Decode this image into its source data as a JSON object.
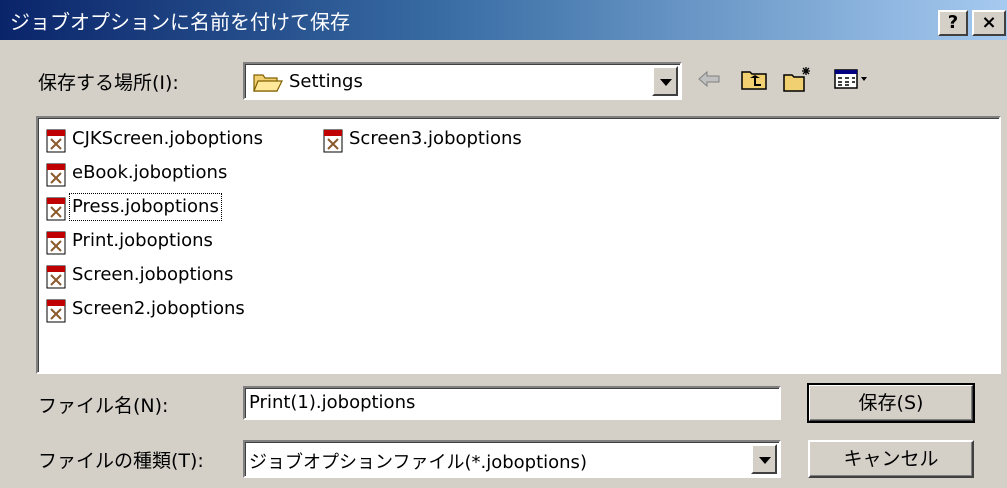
{
  "window": {
    "title": "ジョブオプションに名前を付けて保存",
    "help_button": "?",
    "close_button": "×"
  },
  "save_in": {
    "label": "保存する場所(I):",
    "value": "Settings"
  },
  "toolbar": {
    "icons": [
      "back-arrow-icon",
      "up-one-level-icon",
      "new-folder-icon",
      "view-menu-icon"
    ]
  },
  "file_list": {
    "items": [
      {
        "name": "CJKScreen.joboptions"
      },
      {
        "name": "Screen3.joboptions"
      },
      {
        "name": "eBook.joboptions"
      },
      {
        "name": "Press.joboptions"
      },
      {
        "name": "Print.joboptions"
      },
      {
        "name": "Screen.joboptions"
      },
      {
        "name": "Screen2.joboptions"
      }
    ],
    "focused": "Press.joboptions"
  },
  "file_name": {
    "label": "ファイル名(N):",
    "value": "Print(1).joboptions"
  },
  "file_type": {
    "label": "ファイルの種類(T):",
    "value": "ジョブオプションファイル(*.joboptions)"
  },
  "buttons": {
    "save": "保存(S)",
    "cancel": "キャンセル"
  }
}
